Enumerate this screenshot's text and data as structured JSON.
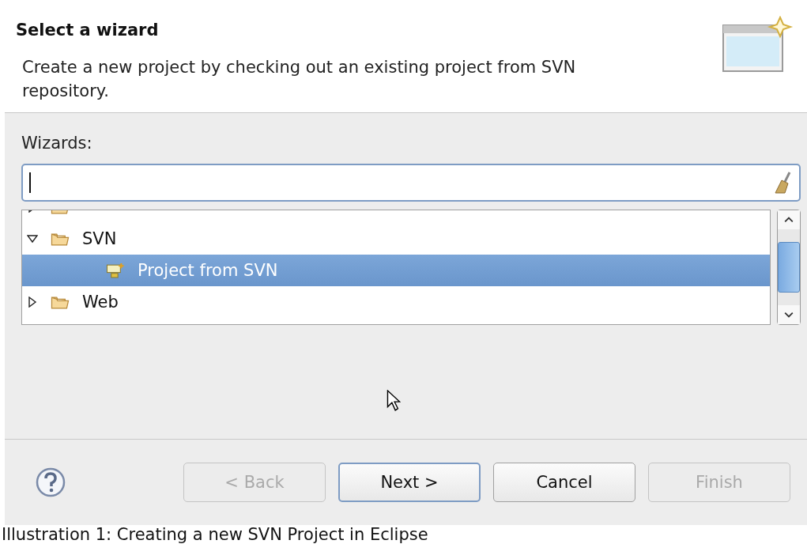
{
  "header": {
    "title": "Select a wizard",
    "description": "Create a new project by checking out an existing project from SVN repository."
  },
  "wizards": {
    "label": "Wizards:",
    "tree": [
      {
        "kind": "folder",
        "expanded": false,
        "selected": false
      },
      {
        "label": "SVN",
        "kind": "folder",
        "expanded": true,
        "selected": false,
        "children": [
          {
            "label": "Project from SVN",
            "kind": "wizard",
            "selected": true
          }
        ]
      },
      {
        "label": "Web",
        "kind": "folder",
        "expanded": false,
        "selected": false
      }
    ]
  },
  "buttons": [
    {
      "label": "< Back",
      "disabled": true,
      "default": false
    },
    {
      "label": "Next >",
      "disabled": false,
      "default": true
    },
    {
      "label": "Cancel",
      "disabled": false,
      "default": false
    },
    {
      "label": "Finish",
      "disabled": true,
      "default": false
    }
  ],
  "caption": "Illustration 1: Creating a new SVN Project in Eclipse"
}
